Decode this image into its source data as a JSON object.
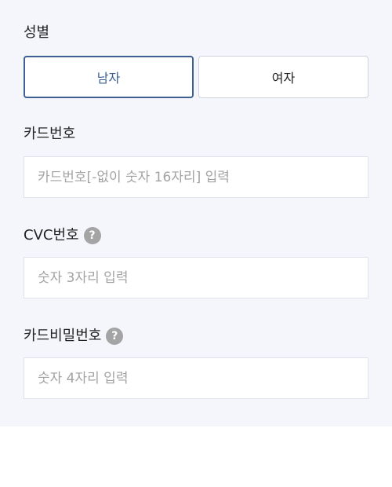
{
  "gender": {
    "label": "성별",
    "options": [
      "남자",
      "여자"
    ],
    "selected": "남자"
  },
  "card_number": {
    "label": "카드번호",
    "placeholder": "카드번호[-없이 숫자 16자리] 입력",
    "value": ""
  },
  "cvc": {
    "label": "CVC번호",
    "help_icon": "question-mark",
    "placeholder": "숫자 3자리 입력",
    "value": ""
  },
  "card_password": {
    "label": "카드비밀번호",
    "help_icon": "question-mark",
    "placeholder": "숫자 4자리 입력",
    "value": ""
  },
  "colors": {
    "accent": "#3d5f91",
    "panel_bg": "#f4f6fb",
    "placeholder": "#a3a3a3",
    "help_icon_bg": "#a4a4a4"
  }
}
